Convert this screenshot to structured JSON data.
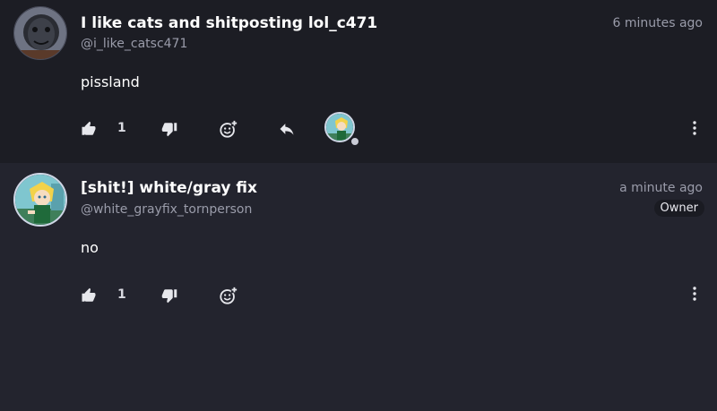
{
  "comments": [
    {
      "author": "I like cats and shitposting lol_c471",
      "handle": "@i_like_catsc471",
      "time": "6 minutes ago",
      "text": "pissland",
      "likes": "1"
    },
    {
      "author": "[shit!] white/gray fix",
      "handle": "@white_grayfix_tornperson",
      "time": "a minute ago",
      "badge": "Owner",
      "text": "no",
      "likes": "1"
    }
  ],
  "icons": {
    "like": "thumbs-up-icon",
    "dislike": "thumbs-down-icon",
    "react": "add-reaction-icon",
    "reply": "reply-icon",
    "more": "more-vertical-icon"
  },
  "colors": {
    "background_first": "#1c1d24",
    "background_second": "#23242e",
    "secondary_text": "#9a9caa"
  }
}
